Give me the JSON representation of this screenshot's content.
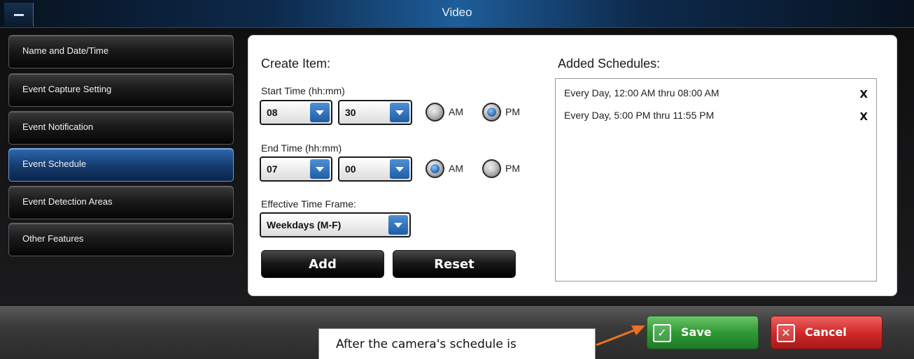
{
  "window": {
    "title": "Video"
  },
  "sidebar": {
    "items": [
      {
        "label": "Name and Date/Time"
      },
      {
        "label": "Event Capture Setting"
      },
      {
        "label": "Event Notification"
      },
      {
        "label": "Event Schedule",
        "active": true
      },
      {
        "label": "Event Detection Areas"
      },
      {
        "label": "Other Features"
      }
    ]
  },
  "create_item": {
    "heading": "Create Item:",
    "start_time": {
      "label": "Start Time (hh:mm)",
      "hour": "08",
      "minute": "30",
      "period": "PM"
    },
    "end_time": {
      "label": "End Time (hh:mm)",
      "hour": "07",
      "minute": "00",
      "period": "AM"
    },
    "am_label": "AM",
    "pm_label": "PM",
    "time_frame": {
      "label": "Effective Time Frame:",
      "value": "Weekdays (M-F)"
    },
    "add_label": "Add",
    "reset_label": "Reset"
  },
  "added_schedules": {
    "heading": "Added Schedules:",
    "items": [
      {
        "text": "Every Day, 12:00 AM thru 08:00 AM",
        "remove": "X"
      },
      {
        "text": "Every Day, 5:00 PM thru 11:55 PM",
        "remove": "X"
      }
    ]
  },
  "footer": {
    "save_label": "Save",
    "save_icon": "checkmark-icon",
    "cancel_label": "Cancel",
    "cancel_icon": "close-icon",
    "save_color": "#2e9a35",
    "cancel_color": "#d22a2a"
  },
  "callout": {
    "text": "After the camera's schedule is",
    "arrow_color": "#f07020"
  }
}
